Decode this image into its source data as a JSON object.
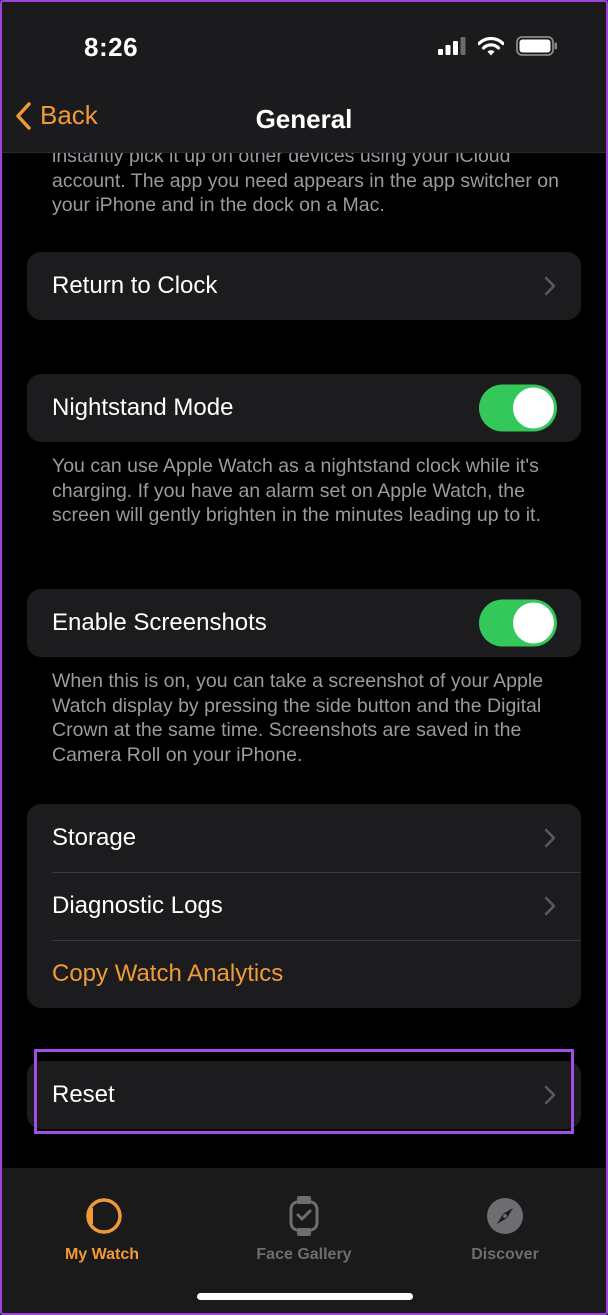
{
  "status_bar": {
    "time": "8:26"
  },
  "nav": {
    "back_label": "Back",
    "title": "General"
  },
  "handoff_footnote": "instantly pick it up on other devices using your iCloud account. The app you need appears in the app switcher on your iPhone and in the dock on a Mac.",
  "return_to_clock": {
    "label": "Return to Clock"
  },
  "nightstand": {
    "label": "Nightstand Mode",
    "enabled": true,
    "footnote": "You can use Apple Watch as a nightstand clock while it's charging. If you have an alarm set on Apple Watch, the screen will gently brighten in the minutes leading up to it."
  },
  "screenshots": {
    "label": "Enable Screenshots",
    "enabled": true,
    "footnote": "When this is on, you can take a screenshot of your Apple Watch display by pressing the side button and the Digital Crown at the same time. Screenshots are saved in the Camera Roll on your iPhone."
  },
  "storage_group": {
    "storage": "Storage",
    "diagnostic_logs": "Diagnostic Logs",
    "copy_analytics": "Copy Watch Analytics"
  },
  "reset": {
    "label": "Reset"
  },
  "tabbar": {
    "my_watch": "My Watch",
    "face_gallery": "Face Gallery",
    "discover": "Discover",
    "active": "my_watch"
  },
  "colors": {
    "accent": "#f09a37",
    "toggle_on": "#34c759",
    "highlight": "#a24de6",
    "background": "#000000",
    "cell": "#1c1c1e"
  },
  "icons": [
    "back-chevron-icon",
    "chevron-right-icon",
    "cellular-signal-icon",
    "wifi-icon",
    "battery-icon",
    "watch-icon",
    "face-gallery-icon",
    "compass-icon"
  ]
}
